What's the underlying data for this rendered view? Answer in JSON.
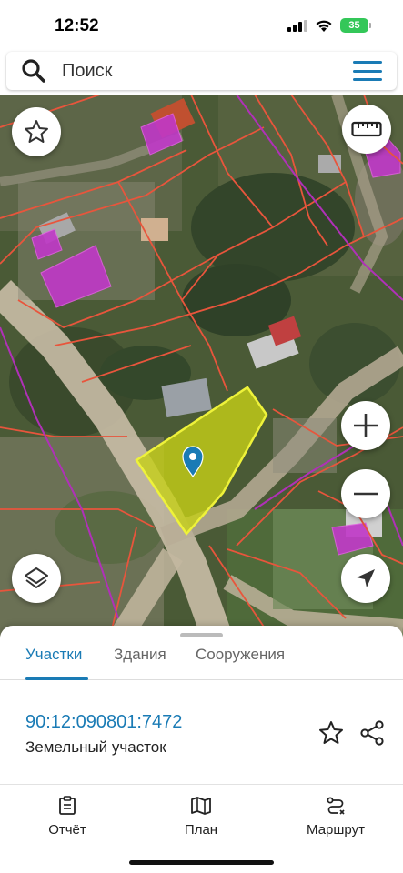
{
  "status_bar": {
    "time": "12:52",
    "battery": "35"
  },
  "search": {
    "placeholder": "Поиск",
    "icon": "search-icon",
    "menu_icon": "hamburger-menu-icon"
  },
  "map": {
    "buttons": {
      "favorite": "star-icon",
      "ruler": "ruler-icon",
      "zoom_in": "plus-icon",
      "zoom_out": "minus-icon",
      "layers": "layers-icon",
      "locate": "navigation-arrow-icon"
    },
    "colors": {
      "parcel_border": "#e8553c",
      "building_fill": "#c040c8",
      "road_line": "#b030b8",
      "selected_parcel": "#c6cf17",
      "pin": "#1a7bb5"
    }
  },
  "sheet": {
    "tabs": [
      {
        "label": "Участки",
        "active": true
      },
      {
        "label": "Здания",
        "active": false
      },
      {
        "label": "Сооружения",
        "active": false
      }
    ],
    "parcel": {
      "cadastral_number": "90:12:090801:7472",
      "type": "Земельный участок"
    },
    "nav": [
      {
        "label": "Отчёт",
        "icon": "report-icon"
      },
      {
        "label": "План",
        "icon": "map-plan-icon"
      },
      {
        "label": "Маршрут",
        "icon": "route-icon"
      }
    ]
  },
  "accent_color": "#1a7bb5"
}
